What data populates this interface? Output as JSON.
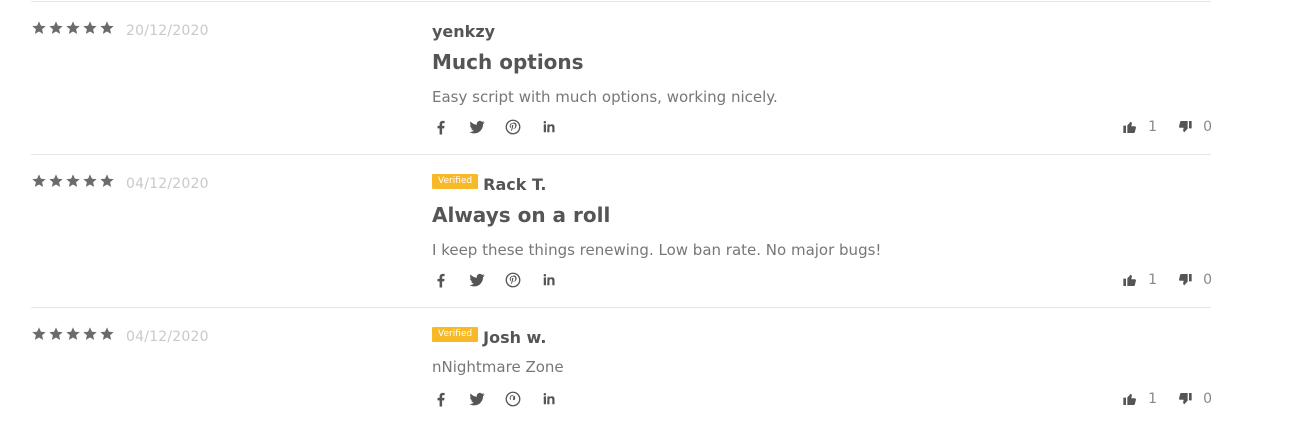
{
  "reviews": [
    {
      "rating": 5,
      "date": "20/12/2020",
      "verified": false,
      "verified_label": "",
      "author": "yenkzy",
      "title": "Much options",
      "body": "Easy script with much options, working nicely.",
      "upvotes": "1",
      "downvotes": "0"
    },
    {
      "rating": 5,
      "date": "04/12/2020",
      "verified": true,
      "verified_label": "Verified",
      "author": "Rack T.",
      "title": "Always on a roll",
      "body": "I keep these things renewing. Low ban rate. No major bugs!",
      "upvotes": "1",
      "downvotes": "0"
    },
    {
      "rating": 5,
      "date": "04/12/2020",
      "verified": true,
      "verified_label": "Verified",
      "author": "Josh w.",
      "title": "",
      "body": "nNightmare Zone",
      "upvotes": "1",
      "downvotes": "0"
    }
  ],
  "share_icons": [
    "facebook-icon",
    "twitter-icon",
    "pinterest-icon",
    "linkedin-icon"
  ],
  "colors": {
    "star": "#6b6b6b",
    "badge": "#f7b928",
    "text": "#555555",
    "muted": "#c9c9c9"
  }
}
